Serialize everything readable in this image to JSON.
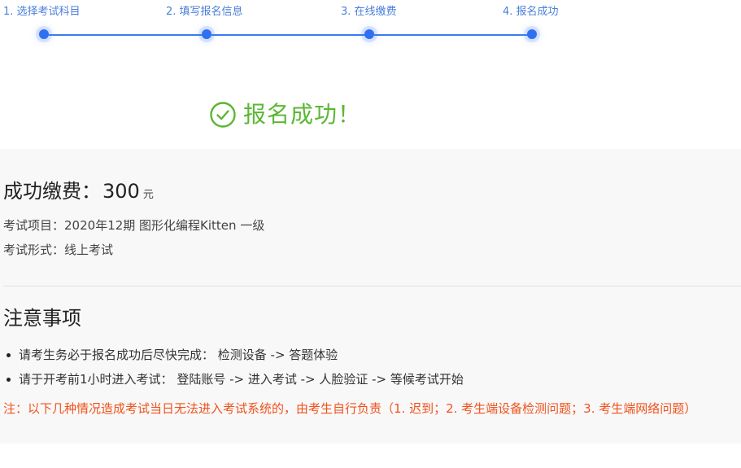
{
  "stepper": {
    "steps": [
      {
        "label": "1. 选择考试科目"
      },
      {
        "label": "2. 填写报名信息"
      },
      {
        "label": "3. 在线缴费"
      },
      {
        "label": "4. 报名成功"
      }
    ],
    "active_color": "#3b7cf0"
  },
  "result": {
    "icon": "check-circle-icon",
    "message": "报名成功！",
    "color": "#5bb734"
  },
  "payment": {
    "label": "成功缴费：",
    "amount": "300",
    "unit": "元"
  },
  "exam": {
    "subject_label": "考试项目：",
    "subject_value": "2020年12期 图形化编程Kitten 一级",
    "mode_label": "考试形式：",
    "mode_value": "线上考试"
  },
  "notice": {
    "title": "注意事项",
    "items": [
      "请考生务必于报名成功后尽快完成： 检测设备 -> 答题体验",
      "请于开考前1小时进入考试： 登陆账号 -> 进入考试 -> 人脸验证 -> 等候考试开始"
    ],
    "warning": "注：以下几种情况造成考试当日无法进入考试系统的，由考生自行负责（1. 迟到；2. 考生端设备检测问题；3. 考生端网络问题）",
    "warning_color": "#f0521d"
  }
}
